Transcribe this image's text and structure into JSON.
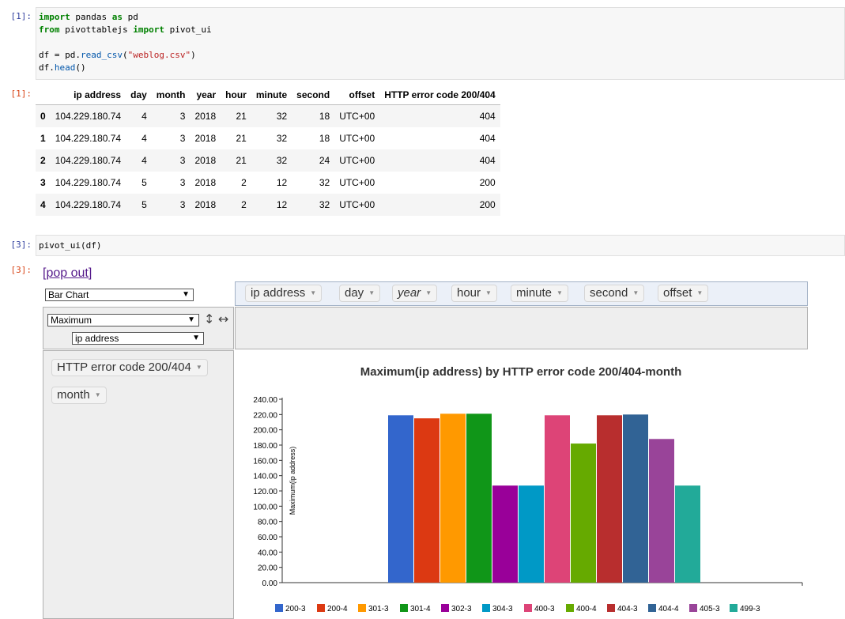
{
  "cells": {
    "c1": {
      "prompt_in": "[1]:",
      "code_lines": [
        {
          "kw": "import",
          "rest": " pandas ",
          "kw2": "as",
          "rest2": " pd"
        },
        {
          "kw": "from",
          "rest": " pivottablejs ",
          "kw2": "import",
          "rest2": " pivot_ui"
        },
        {
          "plain": ""
        },
        {
          "pre": "df = pd.",
          "attr": "read_csv",
          "open": "(",
          "str": "\"weblog.csv\"",
          "close": ")"
        },
        {
          "pre": "df.",
          "attr": "head",
          "open": "()"
        }
      ],
      "prompt_out": "[1]:"
    },
    "c3": {
      "prompt_in": "[3]:",
      "code": "pivot_ui(df)",
      "prompt_out": "[3]:"
    }
  },
  "dataframe": {
    "columns": [
      "",
      "ip address",
      "day",
      "month",
      "year",
      "hour",
      "minute",
      "second",
      "offset",
      "HTTP error code 200/404"
    ],
    "rows": [
      [
        "0",
        "104.229.180.74",
        "4",
        "3",
        "2018",
        "21",
        "32",
        "18",
        "UTC+00",
        "404"
      ],
      [
        "1",
        "104.229.180.74",
        "4",
        "3",
        "2018",
        "21",
        "32",
        "18",
        "UTC+00",
        "404"
      ],
      [
        "2",
        "104.229.180.74",
        "4",
        "3",
        "2018",
        "21",
        "32",
        "24",
        "UTC+00",
        "404"
      ],
      [
        "3",
        "104.229.180.74",
        "5",
        "3",
        "2018",
        "2",
        "12",
        "32",
        "UTC+00",
        "200"
      ],
      [
        "4",
        "104.229.180.74",
        "5",
        "3",
        "2018",
        "2",
        "12",
        "32",
        "UTC+00",
        "200"
      ]
    ]
  },
  "pivot": {
    "pop_out": "[pop out]",
    "renderer": "Bar Chart",
    "aggregator": "Maximum",
    "agg_attr": "ip address",
    "sort_row_icon": "↕",
    "sort_col_icon": "↔",
    "unused_attrs": [
      "ip address",
      "day",
      "year",
      "hour",
      "minute",
      "second",
      "offset"
    ],
    "row_attrs": [
      "HTTP error code 200/404",
      "month"
    ]
  },
  "chart_data": {
    "type": "bar",
    "title": "Maximum(ip address) by HTTP error code 200/404-month",
    "ylabel": "Maximum(ip address)",
    "ylim": [
      0,
      240
    ],
    "yticks": [
      "0.00",
      "20.00",
      "40.00",
      "60.00",
      "80.00",
      "100.00",
      "120.00",
      "140.00",
      "160.00",
      "180.00",
      "200.00",
      "220.00",
      "240.00"
    ],
    "categories": [
      "200-3",
      "200-4",
      "301-3",
      "301-4",
      "302-3",
      "304-3",
      "400-3",
      "400-4",
      "404-3",
      "404-4",
      "405-3",
      "499-3"
    ],
    "values": [
      219,
      215,
      221,
      221,
      127,
      127,
      219,
      182,
      219,
      220,
      188,
      127
    ],
    "colors": [
      "#3366cc",
      "#dc3912",
      "#ff9900",
      "#109618",
      "#990099",
      "#0099c6",
      "#dd4477",
      "#66aa00",
      "#b82e2e",
      "#316395",
      "#994499",
      "#22aa99"
    ]
  }
}
